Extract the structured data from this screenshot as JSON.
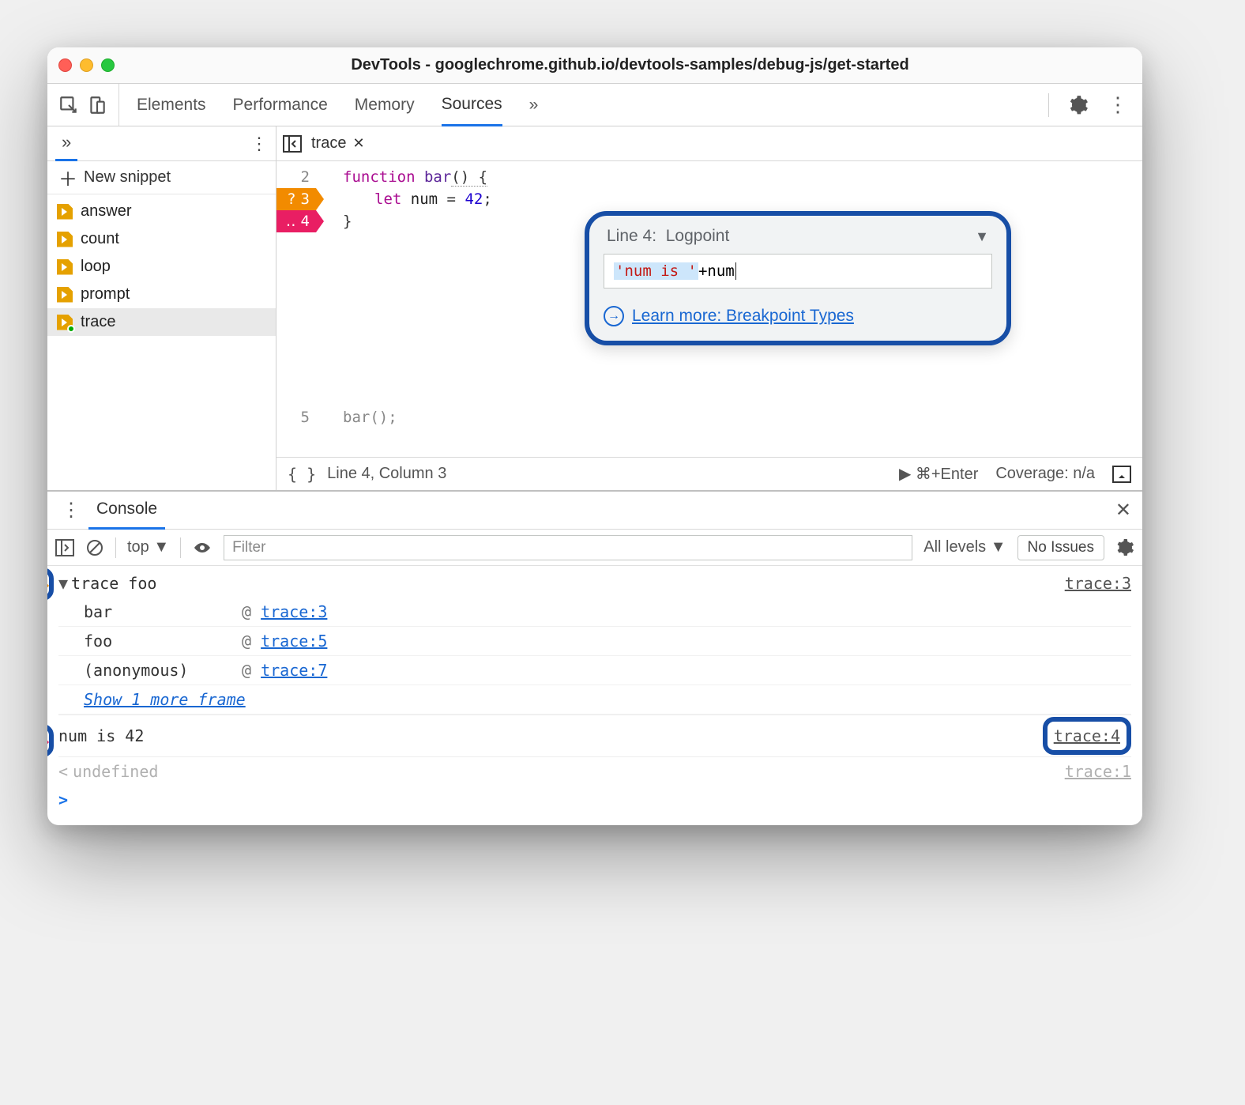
{
  "window": {
    "title": "DevTools - googlechrome.github.io/devtools-samples/debug-js/get-started"
  },
  "toolbar": {
    "tabs": [
      "Elements",
      "Performance",
      "Memory",
      "Sources"
    ],
    "overflow": "»",
    "active_index": 3
  },
  "sidebar": {
    "overflow": "»",
    "new_snippet": "New snippet",
    "files": [
      "answer",
      "count",
      "loop",
      "prompt",
      "trace"
    ],
    "active_index": 4
  },
  "editor": {
    "tab": {
      "name": "trace"
    },
    "code": {
      "lines": [
        {
          "n": "2",
          "kw": "function",
          "fn": "bar",
          "rest": "() {"
        },
        {
          "n": "3",
          "kw": "let",
          "name": "num",
          "eq": " = ",
          "num": "42",
          "semi": ";"
        },
        {
          "n": "4",
          "text": "}"
        },
        {
          "n": "5",
          "text": "bar();"
        }
      ]
    },
    "popup": {
      "line_label": "Line 4:",
      "type": "Logpoint",
      "input_string": "'num is '",
      "input_plus": " + ",
      "input_var": "num",
      "learn_more": "Learn more: Breakpoint Types"
    },
    "status": {
      "pos": "Line 4, Column 3",
      "run_hint": "⌘+Enter",
      "coverage": "Coverage: n/a"
    }
  },
  "drawer": {
    "tab": "Console"
  },
  "console": {
    "context": "top",
    "filter_placeholder": "Filter",
    "levels": "All levels",
    "issues": "No Issues",
    "entries": {
      "trace_label": "trace foo",
      "trace_src": "trace:3",
      "stack": [
        {
          "fn": "bar",
          "src": "trace:3"
        },
        {
          "fn": "foo",
          "src": "trace:5"
        },
        {
          "fn": "(anonymous)",
          "src": "trace:7"
        }
      ],
      "show_more": "Show 1 more frame",
      "log_msg": "num is 42",
      "log_src": "trace:4",
      "undef": "undefined",
      "undef_src": "trace:1"
    }
  }
}
